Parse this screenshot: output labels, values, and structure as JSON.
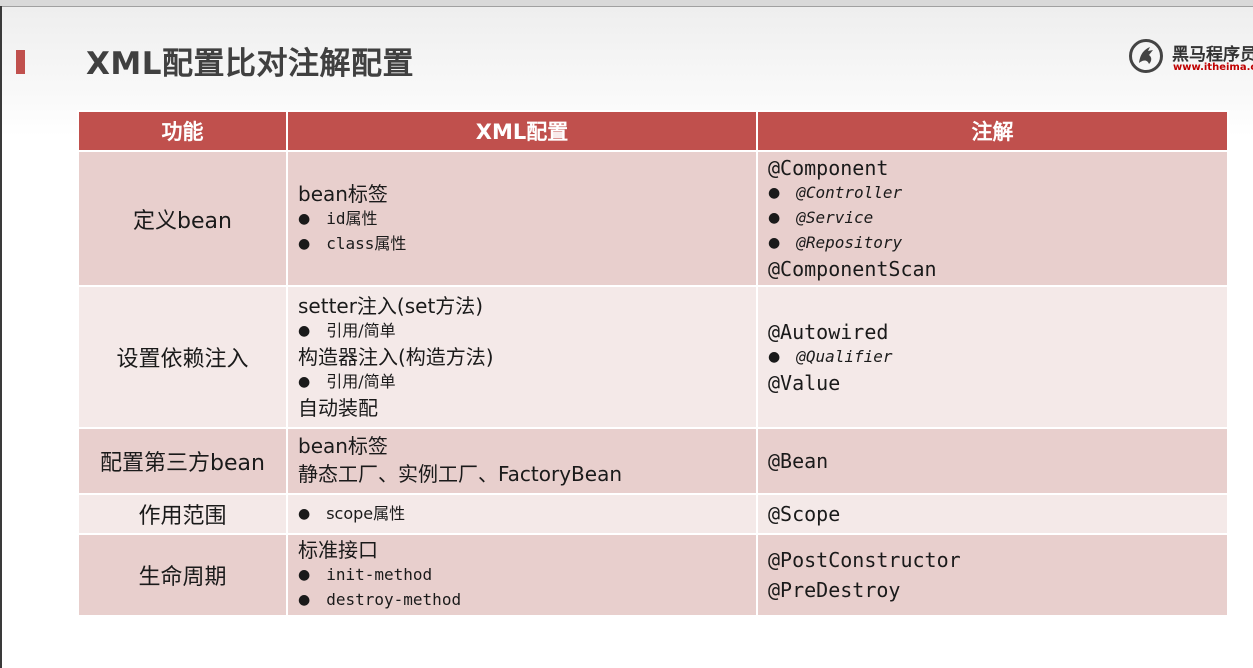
{
  "slide": {
    "title": "XML配置比对注解配置",
    "logo": {
      "name": "黑马程序员",
      "url": "www.itheima.com"
    }
  },
  "table": {
    "headers": [
      "功能",
      "XML配置",
      "注解"
    ],
    "rows": [
      {
        "feature": "定义bean",
        "xml": [
          {
            "text": "bean标签",
            "level": 0
          },
          {
            "text": "id属性",
            "level": 1
          },
          {
            "text": "class属性",
            "level": 1
          }
        ],
        "annotation": [
          {
            "text": "@Component",
            "level": 0
          },
          {
            "text": "@Controller",
            "level": 1
          },
          {
            "text": "@Service",
            "level": 1
          },
          {
            "text": "@Repository",
            "level": 1
          },
          {
            "text": "@ComponentScan",
            "level": 0
          }
        ]
      },
      {
        "feature": "设置依赖注入",
        "xml": [
          {
            "text": "setter注入(set方法)",
            "level": 0
          },
          {
            "text": "引用/简单",
            "level": 1
          },
          {
            "text": "构造器注入(构造方法)",
            "level": 0
          },
          {
            "text": "引用/简单",
            "level": 1
          },
          {
            "text": "自动装配",
            "level": 0
          }
        ],
        "annotation": [
          {
            "text": "@Autowired",
            "level": 0
          },
          {
            "text": "@Qualifier",
            "level": 1
          },
          {
            "text": "@Value",
            "level": 0
          }
        ]
      },
      {
        "feature": "配置第三方bean",
        "xml": [
          {
            "text": "bean标签",
            "level": 0
          },
          {
            "text": "静态工厂、实例工厂、FactoryBean",
            "level": 0
          }
        ],
        "annotation": [
          {
            "text": "@Bean",
            "level": 0
          }
        ]
      },
      {
        "feature": "作用范围",
        "xml": [
          {
            "text": "scope属性",
            "level": 1
          }
        ],
        "annotation": [
          {
            "text": "@Scope",
            "level": 0
          }
        ]
      },
      {
        "feature": "生命周期",
        "xml": [
          {
            "text": "标准接口",
            "level": 0
          },
          {
            "text": "init-method",
            "level": 1
          },
          {
            "text": "destroy-method",
            "level": 1
          }
        ],
        "annotation": [
          {
            "text": "@PostConstructor",
            "level": 0
          },
          {
            "text": "@PreDestroy",
            "level": 0
          }
        ]
      }
    ]
  },
  "colors": {
    "header": "#c0504d",
    "row_dark": "#e8cfcd",
    "row_light": "#f4e9e8",
    "accent": "#c0504d"
  }
}
